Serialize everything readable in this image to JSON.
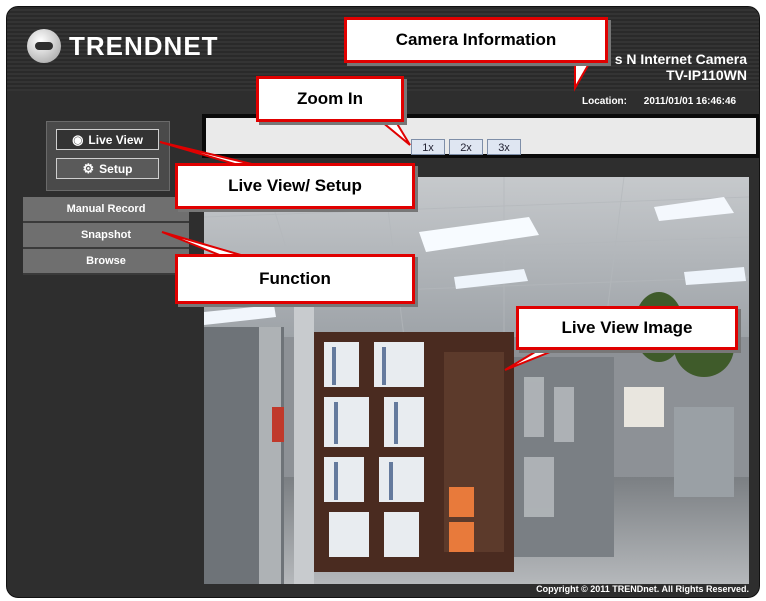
{
  "header": {
    "logo_text": "TRENDNET",
    "product_name": "s N Internet Camera",
    "model": "TV-IP110WN",
    "location_label": "Location:",
    "datetime": "2011/01/01 16:46:46"
  },
  "zoom": {
    "buttons": [
      "1x",
      "2x",
      "3x"
    ]
  },
  "mode": {
    "live_view": "Live View",
    "setup": "Setup"
  },
  "menu": {
    "items": [
      "Manual Record",
      "Snapshot",
      "Browse"
    ]
  },
  "footer": {
    "copyright": "Copyright © 2011 TRENDnet. All Rights Reserved."
  },
  "callouts": {
    "camera_info": "Camera Information",
    "zoom_in": "Zoom In",
    "live_setup": "Live View/ Setup",
    "function": "Function",
    "live_image": "Live View Image"
  },
  "colors": {
    "callout_border": "#e00000",
    "frame_bg": "#2e2e2e",
    "zoom_button_bg": "#dfe6f2"
  }
}
